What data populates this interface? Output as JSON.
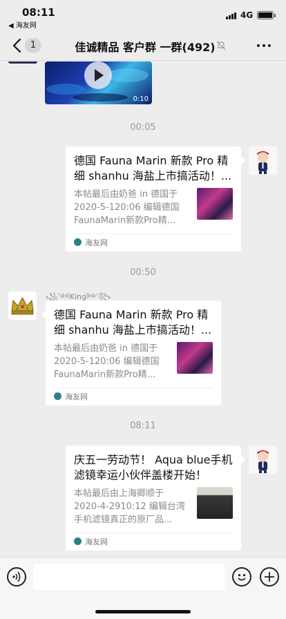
{
  "status_bar": {
    "time": "08:11",
    "back_app": "◀ 海友网",
    "network": "4G"
  },
  "nav": {
    "unread_badge": "1",
    "title": "佳诚精品 客户群 一群(492)"
  },
  "messages": {
    "video": {
      "duration": "0:10"
    },
    "timestamps": [
      "00:05",
      "00:50",
      "08:11"
    ],
    "msg1": {
      "title": "德国 Fauna Marin 新款 Pro 精细 shanhu 海盐上市搞活动！...",
      "desc": "本帖最后由奶爸 in 德国于 2020-5-120:06 编辑德国 FaunaMarin新款Pro精...",
      "source": "海友网"
    },
    "msg2": {
      "sender": "꧁༺King༻꧂",
      "title": "德国 Fauna Marin 新款 Pro 精细 shanhu 海盐上市搞活动！...",
      "desc": "本帖最后由奶爸 in 德国于 2020-5-120:06 编辑德国 FaunaMarin新款Pro精...",
      "source": "海友网"
    },
    "msg3": {
      "title": "庆五一劳动节！ Aqua blue手机滤镜幸运小伙伴盖楼开始！",
      "desc": "本帖最后由上海卿顺于 2020-4-2910:12 编辑台湾手机滤镜真正的原厂品...",
      "source": "海友网"
    }
  },
  "colors": {
    "background": "#ededed",
    "bubble": "#ffffff",
    "meta_text": "#9a9a9a"
  }
}
